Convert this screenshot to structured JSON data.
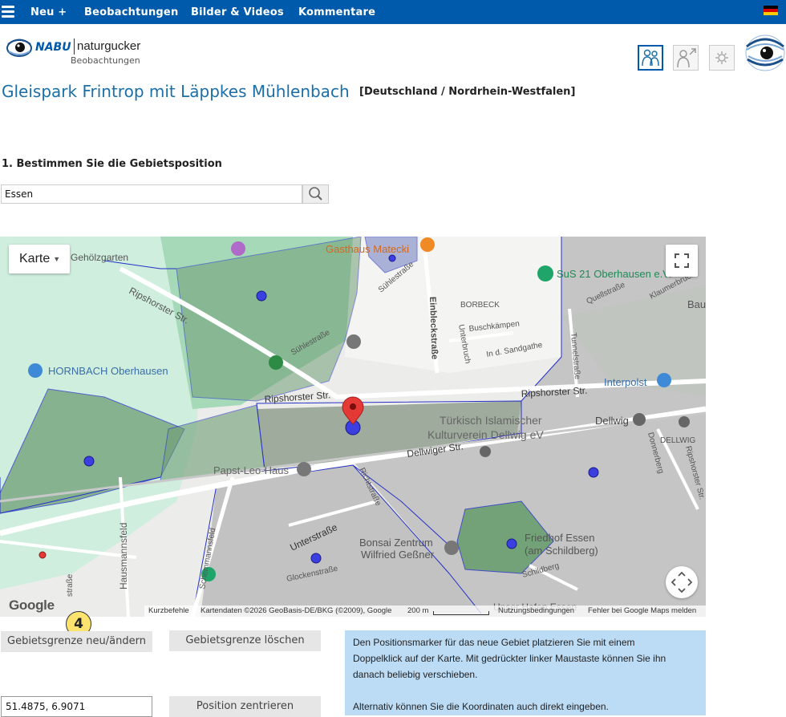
{
  "nav": {
    "items": [
      "Neu +",
      "Beobachtungen",
      "Bilder & Videos",
      "Kommentare"
    ]
  },
  "logo": {
    "brand": "NABU",
    "name": "naturgucker",
    "sub": "Beobachtungen"
  },
  "page": {
    "title": "Gleispark Frintrop mit Läppkes Mühlenbach",
    "region": "[Deutschland / Nordrhein-Westfalen]",
    "step1": "1. Bestimmen Sie die Gebietsposition"
  },
  "search": {
    "value": "Essen"
  },
  "map": {
    "type_label": "Karte",
    "google": "Google",
    "labels": {
      "gehoelzgarten": "Gehölzgarten",
      "gasthaus": "Gasthaus Matecki",
      "sus21": "SuS 21 Oberhausen e.V.",
      "ripshorster1": "Ripshorster Str.",
      "ripshorster2": "Ripshorster Str.",
      "ripshorster3": "Ripshorster Str.",
      "hornbach": "HORNBACH Oberhausen",
      "borbeck": "BORBECK",
      "buschkaempen": "Buschkämpen",
      "sandgathe": "In d. Sandgathe",
      "einbleck": "Einbleckstraße",
      "unterbruch": "Unterbruch",
      "suehle1": "Sühlestraße",
      "suehle2": "Sühlestraße",
      "tunnel": "Tunnelstraße",
      "quell": "Quellstraße",
      "klaumer": "Klaumerbruch",
      "bau": "Bau",
      "interpost": "Interpolst",
      "tuerkisch1": "Türkisch Islamischer",
      "tuerkisch2": "Kulturverein Dellwig eV",
      "dellwig1": "Dellwig",
      "dellwig2": "DELLWIG",
      "dellwiger": "Dellwiger Str.",
      "papst": "Papst-Leo-Haus",
      "bonsai1": "Bonsai Zentrum",
      "bonsai2": "Wilfried Geßner",
      "friedhof1": "Friedhof Essen",
      "friedhof2": "(am Schildberg)",
      "unter": "Unterstraße",
      "glocken": "Glockenstraße",
      "hausmanns": "Hausmannsfeld",
      "schemm": "Schemmannsfeld",
      "donner": "Donnerberg",
      "ripsh_v": "Ripshorster Str.",
      "schildberg": "Schildberg",
      "richt": "Richtstraße",
      "hafen": "Unser Hafen Essen",
      "str": "straße"
    },
    "attribution": {
      "shortcuts": "Kurzbefehle",
      "mapdata": "Kartendaten ©2026 GeoBasis-DE/BKG (©2009), Google",
      "scale": "200 m",
      "terms": "Nutzungsbedingungen",
      "report": "Fehler bei Google Maps melden"
    }
  },
  "badge": "4",
  "buttons": {
    "boundary_edit": "Gebietsgrenze neu/ändern",
    "boundary_delete": "Gebietsgrenze löschen",
    "center": "Position zentrieren"
  },
  "coords": {
    "value": "51.4875, 6.9071"
  },
  "info": {
    "line1": "Den Positionsmarker für das neue Gebiet platzieren Sie mit einem",
    "line2": "Doppelklick auf der Karte. Mit gedrückter linker Maustaste können Sie ihn",
    "line3": "danach beliebig verschieben.",
    "line4": "Alternativ können Sie die Koordinaten auch direkt eingeben."
  },
  "colors": {
    "topbar": "#005aab",
    "title": "#1a6fa8",
    "infobox": "#bcdcf5",
    "badge": "#fbe36d",
    "marker": "#e53935"
  }
}
